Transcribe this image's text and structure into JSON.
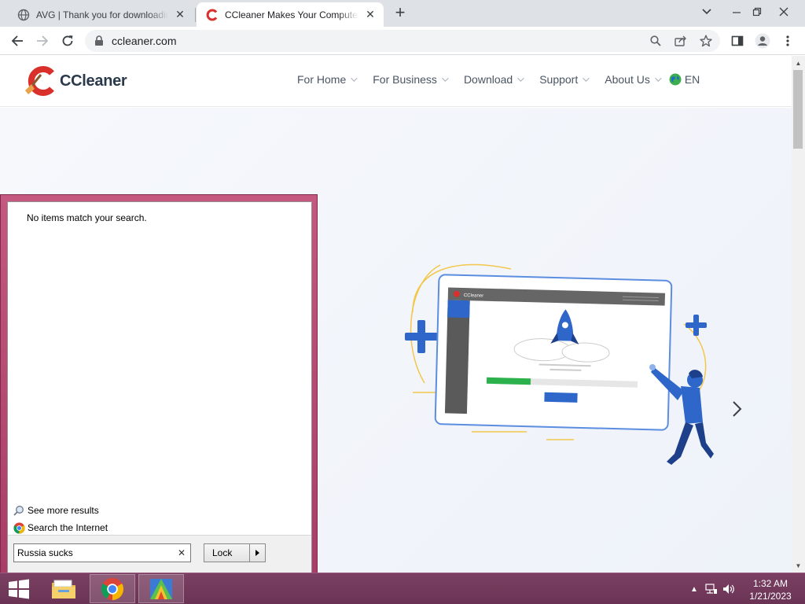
{
  "browser": {
    "tabs": [
      {
        "title": "AVG | Thank you for downloading",
        "active": false
      },
      {
        "title": "CCleaner Makes Your Computer Faster",
        "active": true
      }
    ],
    "url": "ccleaner.com"
  },
  "site": {
    "logo_text": "CCleaner",
    "nav": [
      "For Home",
      "For Business",
      "Download",
      "Support",
      "About Us"
    ],
    "language": "EN",
    "illustration_app_title": "CCleaner"
  },
  "start_menu": {
    "no_results": "No items match your search.",
    "see_more": "See more results",
    "search_internet": "Search the Internet",
    "search_value": "Russia sucks",
    "lock_label": "Lock"
  },
  "taskbar": {
    "apps": [
      "start-icon",
      "file-explorer-icon",
      "chrome-icon",
      "avg-icon"
    ],
    "time": "1:32 AM",
    "date": "1/21/2023"
  },
  "colors": {
    "taskbar": "#6f3758",
    "startmenu_border": "#b84a72",
    "hero_bg": "#f2f5fa",
    "illustration_blue": "#2f66c9"
  }
}
